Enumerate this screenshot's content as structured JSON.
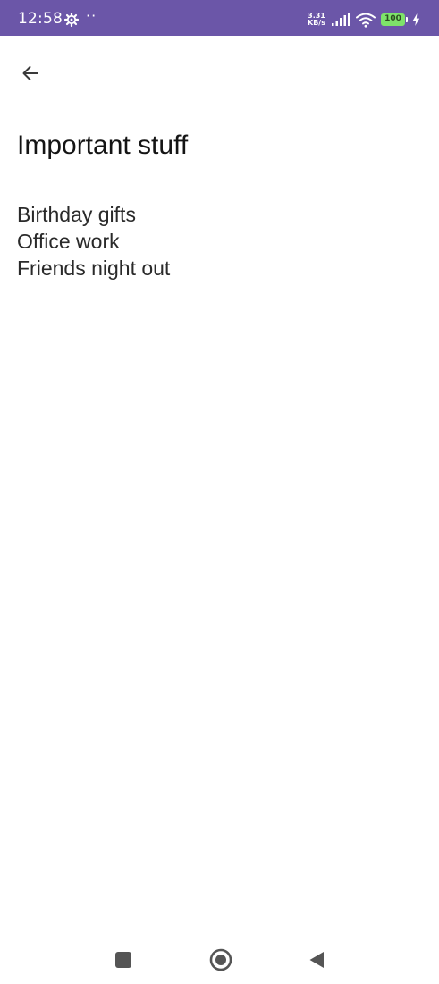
{
  "status_bar": {
    "time": "12:58",
    "dots": "··",
    "net_speed_value": "3.31",
    "net_speed_unit": "KB/s",
    "battery_level": "100",
    "background_color": "#6b56a8",
    "battery_color": "#7ee36a",
    "icons": [
      "gear-icon",
      "signal-icon",
      "wifi-icon",
      "battery-icon",
      "charging-bolt-icon"
    ]
  },
  "header": {
    "back_icon": "arrow-left-icon"
  },
  "note": {
    "title": "Important stuff",
    "lines": [
      "Birthday gifts",
      "Office work",
      "Friends night out"
    ]
  },
  "nav_bar": {
    "icons": [
      "recents-square-icon",
      "home-circle-icon",
      "back-triangle-icon"
    ]
  }
}
